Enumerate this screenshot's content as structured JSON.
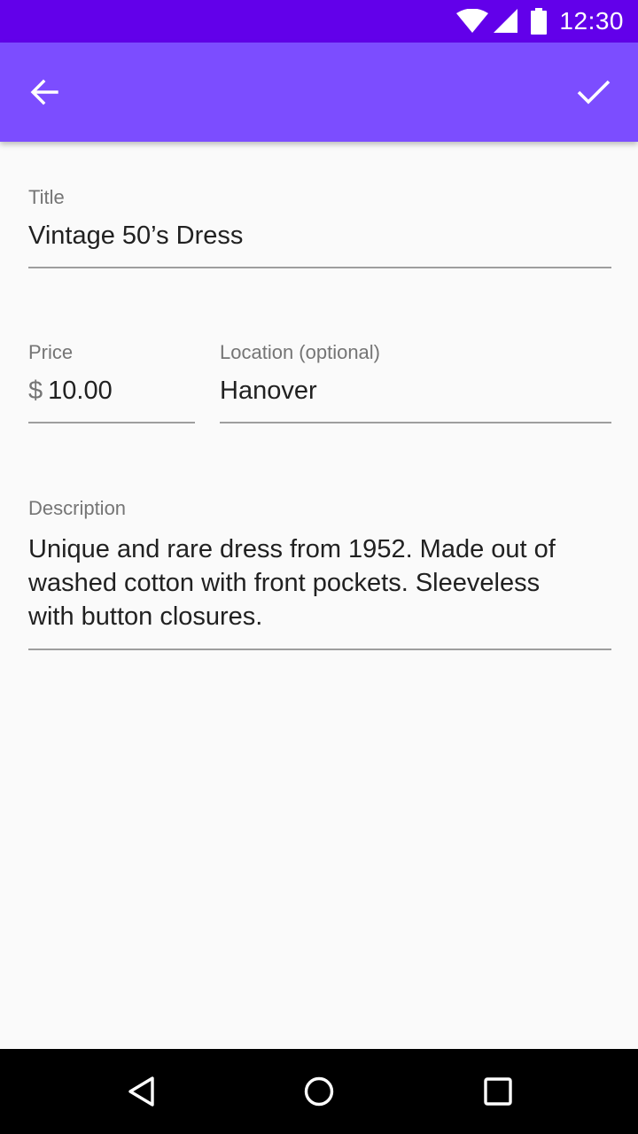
{
  "status_bar": {
    "time": "12:30",
    "icons": [
      "wifi-icon",
      "signal-icon",
      "battery-icon"
    ]
  },
  "app_bar": {
    "background": "#7c4dff",
    "status_background": "#6200ea",
    "back_icon": "arrow-back-icon",
    "confirm_icon": "check-icon"
  },
  "form": {
    "title": {
      "label": "Title",
      "value": "Vintage 50’s Dress"
    },
    "price": {
      "label": "Price",
      "currency": "$",
      "value": "10.00"
    },
    "location": {
      "label": "Location (optional)",
      "value": "Hanover"
    },
    "description": {
      "label": "Description",
      "value": "Unique and rare dress from 1952. Made out of washed cotton with front pockets. Sleeveless with button closures."
    }
  },
  "nav_bar": {
    "icons": [
      "back-triangle-icon",
      "home-circle-icon",
      "recents-square-icon"
    ]
  }
}
